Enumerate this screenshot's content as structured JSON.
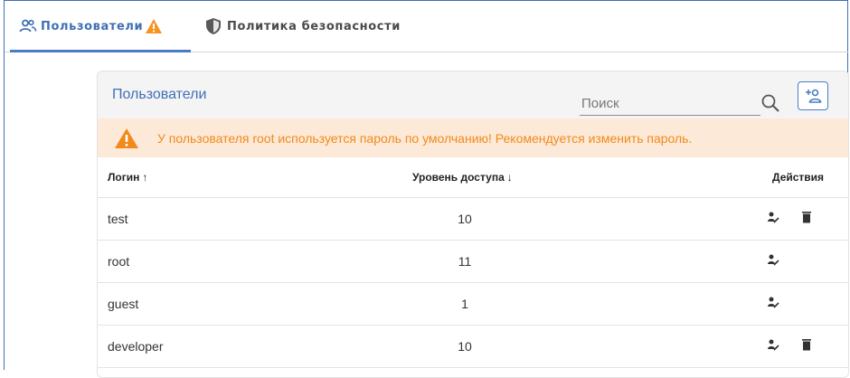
{
  "tabs": [
    {
      "label": "Пользователи",
      "icon": "users-icon",
      "badge_icon": "warning-icon",
      "active": true
    },
    {
      "label": "Политика безопасности",
      "icon": "shield-icon",
      "active": false
    }
  ],
  "card": {
    "title": "Пользователи",
    "search": {
      "placeholder": "Поиск",
      "value": ""
    },
    "add_user_icon": "add-user-icon"
  },
  "warning": {
    "text": "У пользователя root используется пароль по умолчанию! Рекомендуется изменить пароль.",
    "color": "#f08a1c",
    "background": "#fde9d7"
  },
  "table": {
    "columns": {
      "login": "Логин",
      "login_sort": "↑",
      "level": "Уровень доступа",
      "level_sort": "↓",
      "actions": "Действия"
    },
    "rows": [
      {
        "login": "test",
        "level": "10",
        "actions": [
          "edit-user-icon",
          "delete-icon"
        ]
      },
      {
        "login": "root",
        "level": "11",
        "actions": [
          "edit-user-icon"
        ]
      },
      {
        "login": "guest",
        "level": "1",
        "actions": [
          "edit-user-icon"
        ]
      },
      {
        "login": "developer",
        "level": "10",
        "actions": [
          "edit-user-icon",
          "delete-icon"
        ]
      }
    ]
  },
  "colors": {
    "accent": "#3f6fb5",
    "warning": "#f08a1c"
  }
}
